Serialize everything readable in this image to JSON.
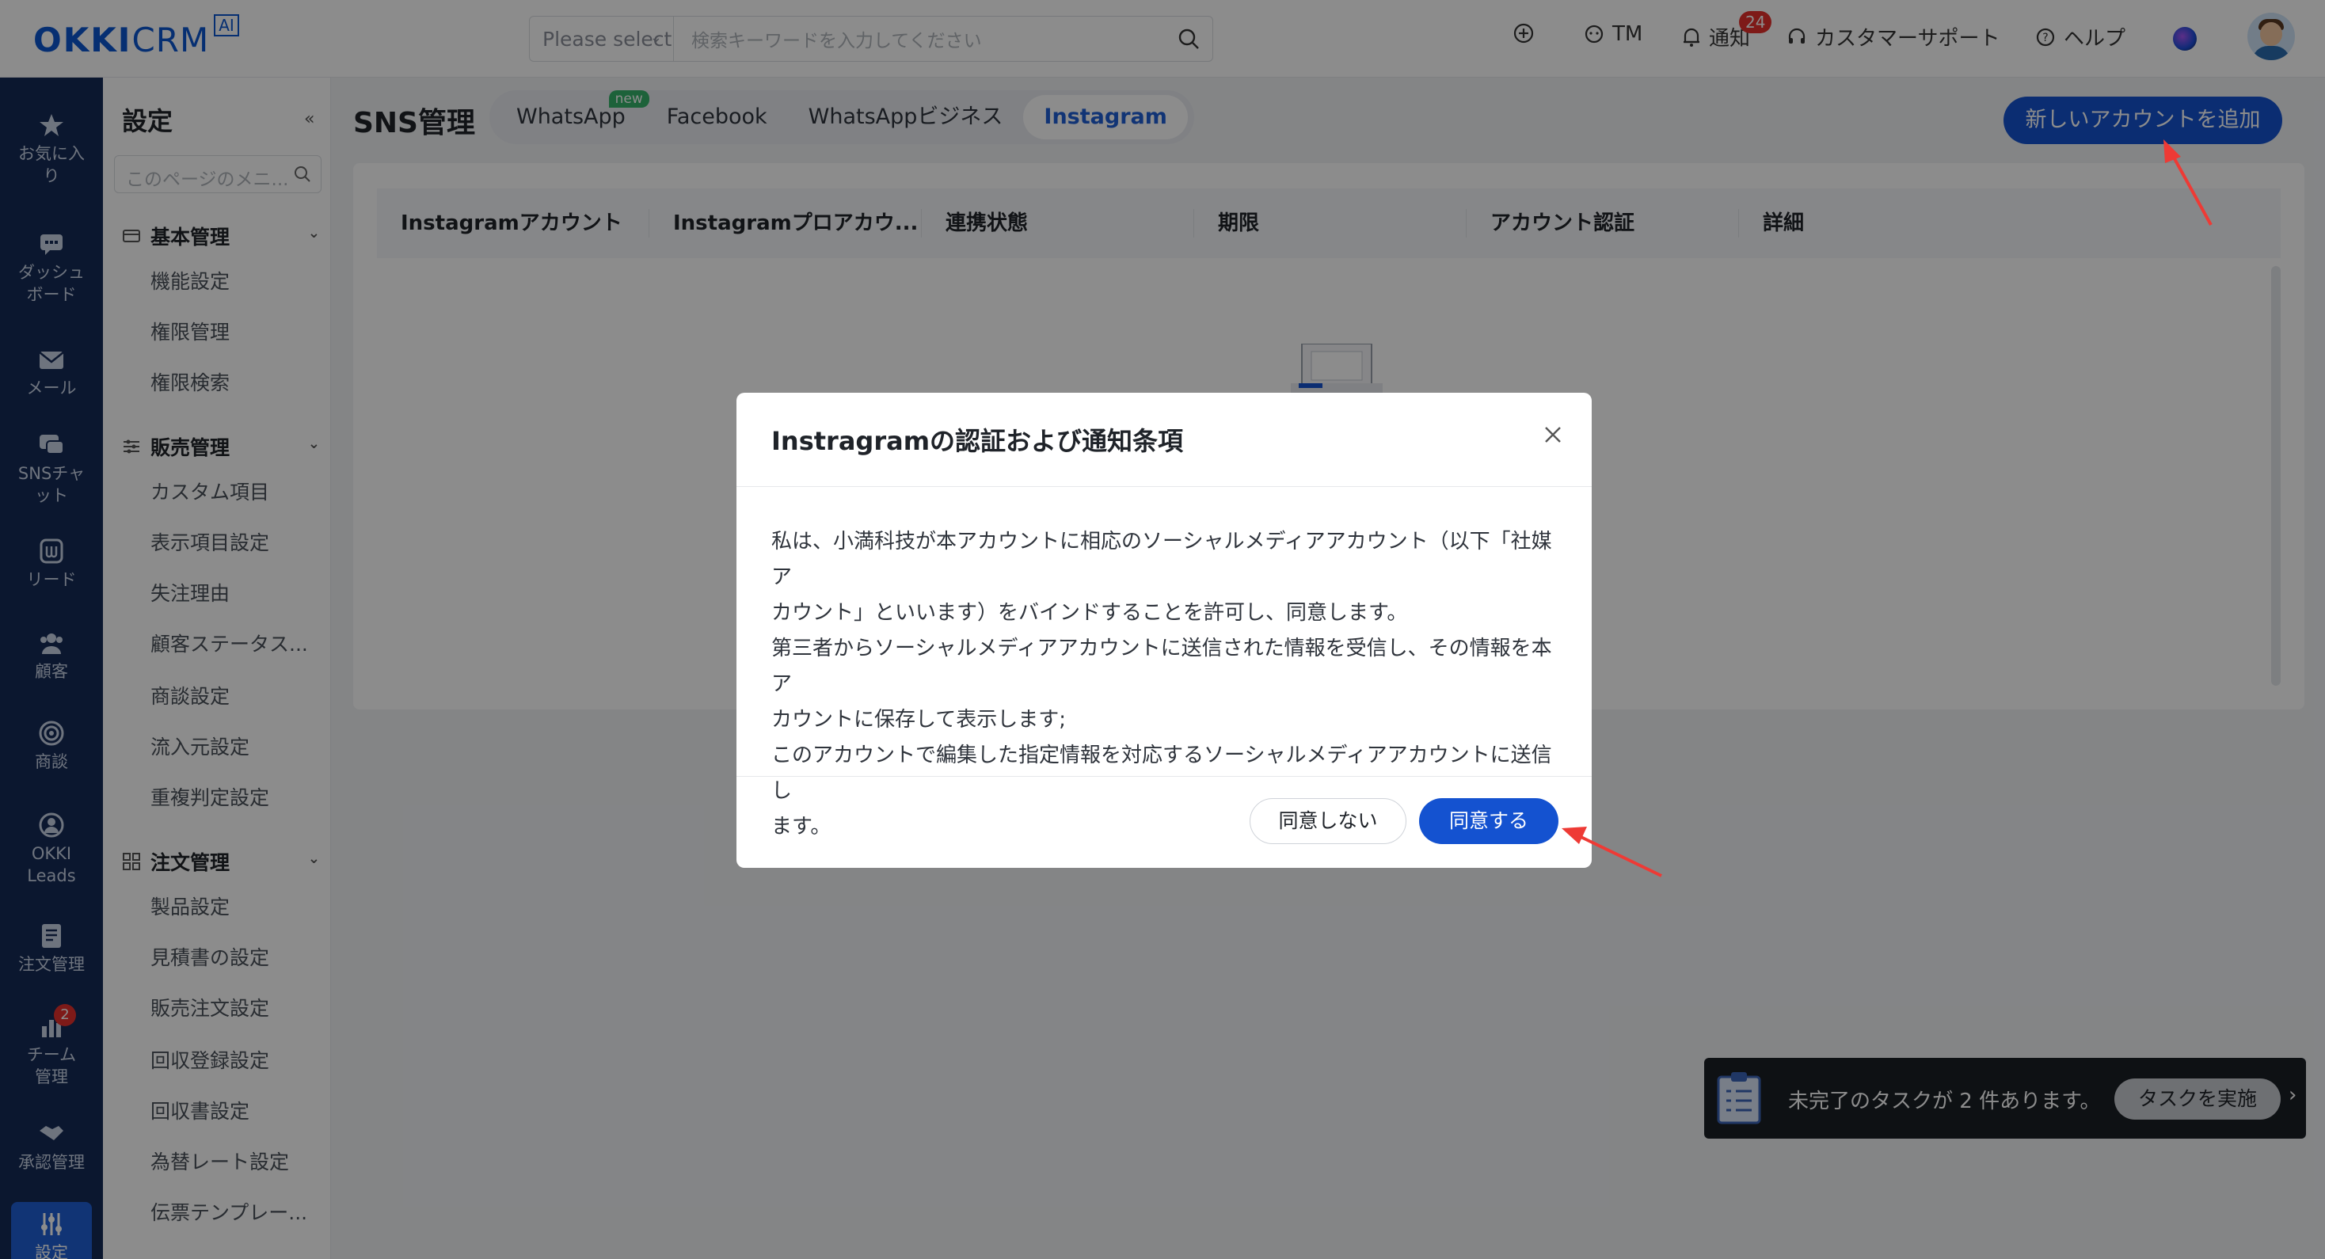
{
  "header": {
    "logo_text": "OKKI",
    "logo_text2": "CRM",
    "logo_badge": "AI",
    "search_select_placeholder": "Please select",
    "search_placeholder": "検索キーワードを入力してください",
    "nav": {
      "tm": "TM",
      "notifications": "通知",
      "notifications_count": "24",
      "support": "カスタマーサポート",
      "help": "ヘルプ"
    }
  },
  "rail": {
    "items": [
      {
        "label_line1": "お気に入",
        "label_line2": "り",
        "icon": "star-icon"
      },
      {
        "label_line1": "ダッシュ",
        "label_line2": "ボード",
        "icon": "dashboard-icon"
      },
      {
        "label_line1": "メール",
        "label_line2": "",
        "icon": "mail-icon"
      },
      {
        "label_line1": "SNSチャ",
        "label_line2": "ット",
        "icon": "chat-icon"
      },
      {
        "label_line1": "リード",
        "label_line2": "",
        "icon": "lead-icon"
      },
      {
        "label_line1": "顧客",
        "label_line2": "",
        "icon": "customers-icon"
      },
      {
        "label_line1": "商談",
        "label_line2": "",
        "icon": "target-icon"
      },
      {
        "label_line1": "OKKI",
        "label_line2": "Leads",
        "icon": "okki-leads-icon"
      },
      {
        "label_line1": "注文管理",
        "label_line2": "",
        "icon": "order-icon"
      },
      {
        "label_line1": "チーム",
        "label_line2": "管理",
        "icon": "team-icon",
        "badge": "2"
      },
      {
        "label_line1": "承認管理",
        "label_line2": "",
        "icon": "handshake-icon"
      },
      {
        "label_line1": "設定",
        "label_line2": "",
        "icon": "settings-sliders-icon",
        "active": true
      }
    ]
  },
  "sidebar": {
    "title": "設定",
    "collapse": "«",
    "search_placeholder": "このページのメニ...",
    "groups": [
      {
        "label": "基本管理",
        "items": [
          "機能設定",
          "権限管理",
          "権限検索"
        ]
      },
      {
        "label": "販売管理",
        "items": [
          "カスタム項目",
          "表示項目設定",
          "失注理由",
          "顧客ステータス...",
          "商談設定",
          "流入元設定",
          "重複判定設定"
        ]
      },
      {
        "label": "注文管理",
        "items": [
          "製品設定",
          "見積書の設定",
          "販売注文設定",
          "回収登録設定",
          "回収書設定",
          "為替レート設定",
          "伝票テンプレー..."
        ]
      }
    ]
  },
  "main": {
    "title": "SNS管理",
    "tabs": [
      {
        "label": "WhatsApp",
        "badge": "new"
      },
      {
        "label": "Facebook"
      },
      {
        "label": "WhatsAppビジネス"
      },
      {
        "label": "Instagram",
        "active": true
      }
    ],
    "add_button": "新しいアカウントを追加",
    "table_headers": [
      "Instagramアカウント",
      "Instagramプロアカウ...",
      "連携状態",
      "期限",
      "アカウント認証",
      "詳細"
    ]
  },
  "modal": {
    "title": "Instragramの認証および通知条項",
    "body_line1": "私は、小満科技が本アカウントに相応のソーシャルメディアアカウント（以下「社媒ア",
    "body_line2": "カウント」といいます）をバインドすることを許可し、同意します。",
    "body_line3": "第三者からソーシャルメディアアカウントに送信された情報を受信し、その情報を本ア",
    "body_line4": "カウントに保存して表示します;",
    "body_line5": "このアカウントで編集した指定情報を対応するソーシャルメディアアカウントに送信し",
    "body_line6": "ます。",
    "disagree": "同意しない",
    "agree": "同意する"
  },
  "toast": {
    "message": "未完了のタスクが 2 件あります。",
    "action": "タスクを実施",
    "chevron": "›"
  },
  "colors": {
    "primary": "#1452d0",
    "rail_bg": "#152a57",
    "badge_red": "#e5312c",
    "new_badge": "#35b36b"
  }
}
